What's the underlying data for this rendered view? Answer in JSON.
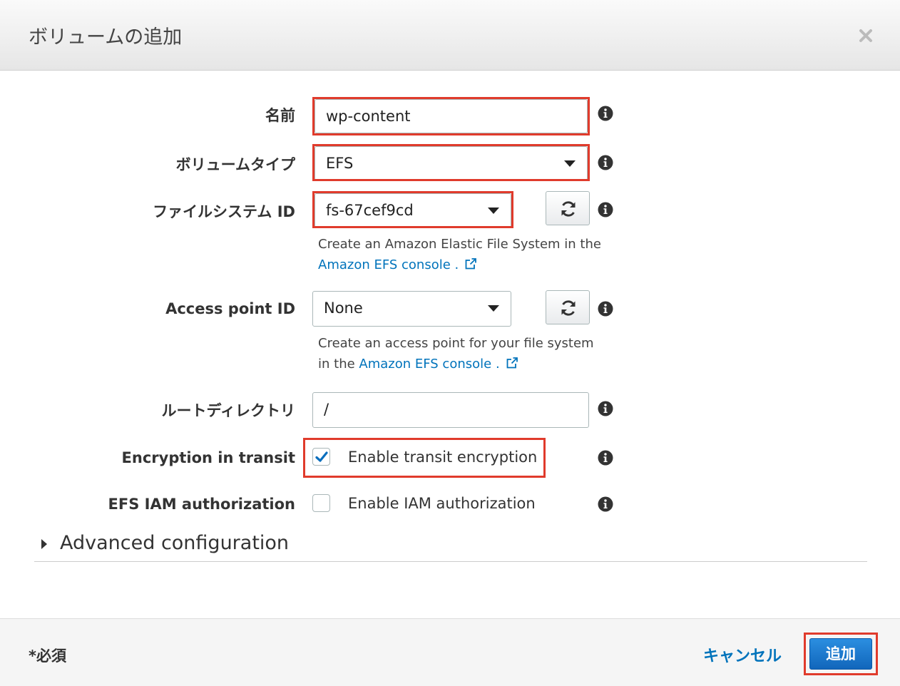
{
  "dialog": {
    "title": "ボリュームの追加"
  },
  "form": {
    "name_label": "名前",
    "name_value": "wp-content",
    "volume_type_label": "ボリュームタイプ",
    "volume_type_value": "EFS",
    "filesystem_label": "ファイルシステム ID",
    "filesystem_value": "fs-67cef9cd",
    "filesystem_hint_text": "Create an Amazon Elastic File System in the",
    "filesystem_hint_link": "Amazon EFS console",
    "filesystem_hint_suffix": " .",
    "access_point_label": "Access point ID",
    "access_point_value": "None",
    "access_point_hint_line1": "Create an access point for your file system",
    "access_point_hint_prefix": "in the ",
    "access_point_hint_link": "Amazon EFS console",
    "access_point_hint_suffix": " .",
    "root_dir_label": "ルートディレクトリ",
    "root_dir_value": "/",
    "encryption_label": "Encryption in transit",
    "encryption_checkbox_label": "Enable transit encryption",
    "encryption_checked": true,
    "iam_label": "EFS IAM authorization",
    "iam_checkbox_label": "Enable IAM authorization",
    "iam_checked": false
  },
  "advanced": {
    "label": "Advanced configuration"
  },
  "footer": {
    "required_note": "*必須",
    "cancel_label": "キャンセル",
    "add_label": "追加"
  },
  "colors": {
    "highlight": "#e03b2c",
    "link": "#0073bb",
    "primary_button": "#1a7bd1"
  }
}
